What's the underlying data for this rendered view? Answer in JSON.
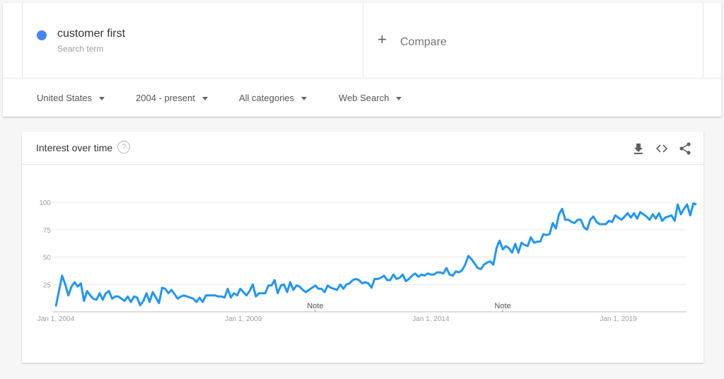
{
  "term": {
    "name": "customer first",
    "subtitle": "Search term",
    "color": "#4285f4"
  },
  "compare": {
    "icon": "plus-icon",
    "label": "Compare"
  },
  "filters": [
    {
      "label": "United States"
    },
    {
      "label": "2004 - present"
    },
    {
      "label": "All categories"
    },
    {
      "label": "Web Search"
    }
  ],
  "card": {
    "title": "Interest over time",
    "help_icon": "?",
    "actions": [
      "download-icon",
      "embed-code-icon",
      "share-icon"
    ]
  },
  "chart_data": {
    "type": "line",
    "title": "Interest over time",
    "xlabel": "",
    "ylabel": "",
    "ylim": [
      0,
      100
    ],
    "yticks": [
      25,
      50,
      75,
      100
    ],
    "xtick_labels": [
      "Jan 1, 2004",
      "Jan 1, 2009",
      "Jan 1, 2014",
      "Jan 1, 2019"
    ],
    "xtick_month_index": [
      0,
      60,
      120,
      180
    ],
    "notes": [
      {
        "label": "Note",
        "month_index": 83
      },
      {
        "label": "Note",
        "month_index": 143
      }
    ],
    "grid": true,
    "legend": "none",
    "x_start": "2004-01",
    "x_frequency": "monthly",
    "series": [
      {
        "name": "customer first",
        "color": "#2196f3",
        "values": [
          5,
          19,
          33,
          25,
          15,
          23,
          27,
          23,
          26,
          10,
          19,
          15,
          12,
          11,
          17,
          11,
          17,
          19,
          12,
          14,
          14,
          12,
          10,
          14,
          9,
          14,
          13,
          6,
          10,
          17,
          9,
          18,
          13,
          8,
          22,
          21,
          17,
          20,
          16,
          12,
          14,
          15,
          14,
          13,
          12,
          9,
          13,
          9,
          15,
          15,
          15,
          15,
          14,
          14,
          13,
          21,
          13,
          17,
          15,
          21,
          18,
          15,
          19,
          25,
          14,
          17,
          17,
          17,
          24,
          24,
          29,
          17,
          24,
          25,
          18,
          27,
          20,
          24,
          23,
          20,
          18,
          20,
          22,
          24,
          21,
          21,
          18,
          24,
          22,
          21,
          20,
          25,
          21,
          25,
          26,
          29,
          30,
          29,
          26,
          27,
          26,
          22,
          30,
          30,
          31,
          33,
          29,
          29,
          34,
          30,
          31,
          34,
          28,
          30,
          33,
          35,
          32,
          34,
          33,
          35,
          34,
          34,
          36,
          36,
          35,
          40,
          34,
          33,
          37,
          36,
          38,
          43,
          51,
          48,
          44,
          40,
          39,
          43,
          45,
          46,
          43,
          58,
          65,
          57,
          60,
          58,
          54,
          62,
          54,
          63,
          61,
          60,
          68,
          63,
          64,
          64,
          71,
          70,
          71,
          81,
          76,
          89,
          94,
          84,
          84,
          82,
          81,
          84,
          84,
          77,
          75,
          84,
          87,
          82,
          80,
          80,
          80,
          83,
          82,
          88,
          86,
          84,
          87,
          90,
          86,
          90,
          85,
          91,
          89,
          87,
          84,
          89,
          85,
          90,
          83,
          86,
          87,
          88,
          83,
          98,
          89,
          94,
          98,
          88,
          99,
          98
        ]
      }
    ]
  }
}
